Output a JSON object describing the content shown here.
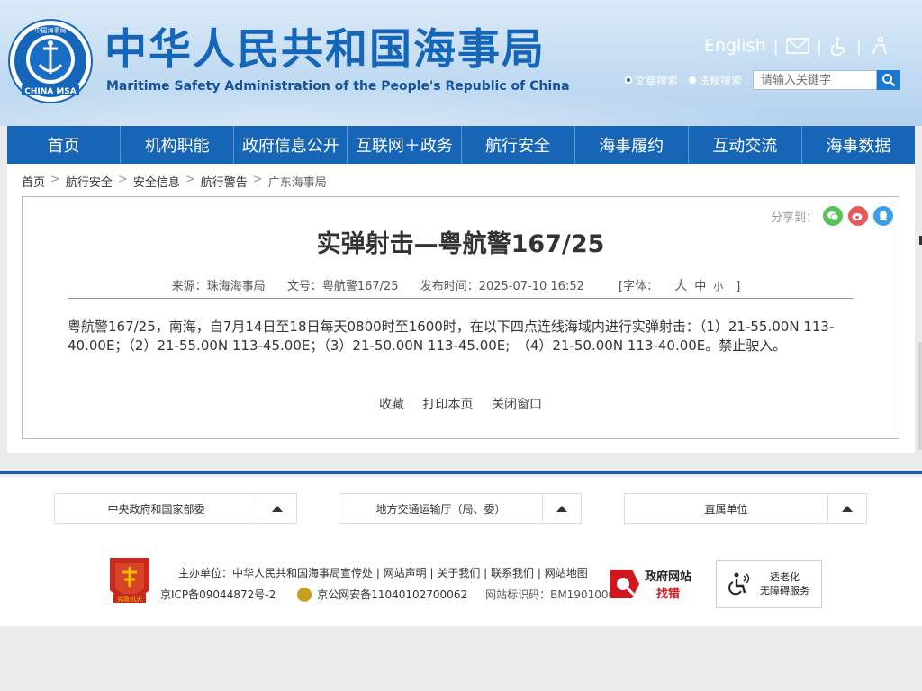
{
  "header": {
    "title": "中华人民共和国海事局",
    "subtitle": "Maritime Safety Administration of the People's Republic of China",
    "logo_text": "CHINA MSA",
    "logo_top_text": "中国海事局",
    "english_link": "English",
    "search": {
      "radio_article": "文章搜索",
      "radio_law": "法规搜索",
      "placeholder": "请输入关键字"
    }
  },
  "nav": {
    "items": [
      "首页",
      "机构职能",
      "政府信息公开",
      "互联网＋政务",
      "航行安全",
      "海事履约",
      "互动交流",
      "海事数据"
    ]
  },
  "breadcrumb": [
    "首页",
    "航行安全",
    "安全信息",
    "航行警告",
    "广东海事局"
  ],
  "breadcrumb_sep": ">",
  "article": {
    "share_label": "分享到：",
    "title": "实弹射击—粤航警167/25",
    "meta": {
      "source": "来源：珠海海事局",
      "doc_no": "文号：粤航警167/25",
      "date": "发布时间：2025-07-10 16:52",
      "font_label": "[字体：",
      "font_large": "大",
      "font_medium": "中",
      "font_small": "小",
      "font_end": "]"
    },
    "body": "粤航警167/25，南海，自7月14日至18日每天0800时至1600时，在以下四点连线海域内进行实弹射击：（1）21-55.00N 113-40.00E；（2）21-55.00N 113-45.00E；（3）21-50.00N 113-45.00E;　（4）21-50.00N 113-40.00E。禁止驶入。",
    "actions": {
      "favorite": "收藏",
      "print": "打印本页",
      "close": "关闭窗口"
    }
  },
  "footer": {
    "dropdowns": [
      "中央政府和国家部委",
      "地方交通运输厅（局、委）",
      "直属单位"
    ],
    "badge_text": "党政机关",
    "line1": "主办单位：中华人民共和国海事局宣传处 | 网站声明 | 关于我们 | 联系我们 | 网站地图",
    "icp": "京ICP备09044872号-2",
    "police": "京公网安备11040102700062",
    "site_id": "网站标识码：BM19010001",
    "findbug_line1": "政府网站",
    "findbug_line2": "找错",
    "access_line1": "适老化",
    "access_line2": "无障碍服务"
  },
  "colors": {
    "nav_blue": "#1665b6",
    "title_blue": "#1565b8",
    "divider": "#1a5fa8"
  }
}
